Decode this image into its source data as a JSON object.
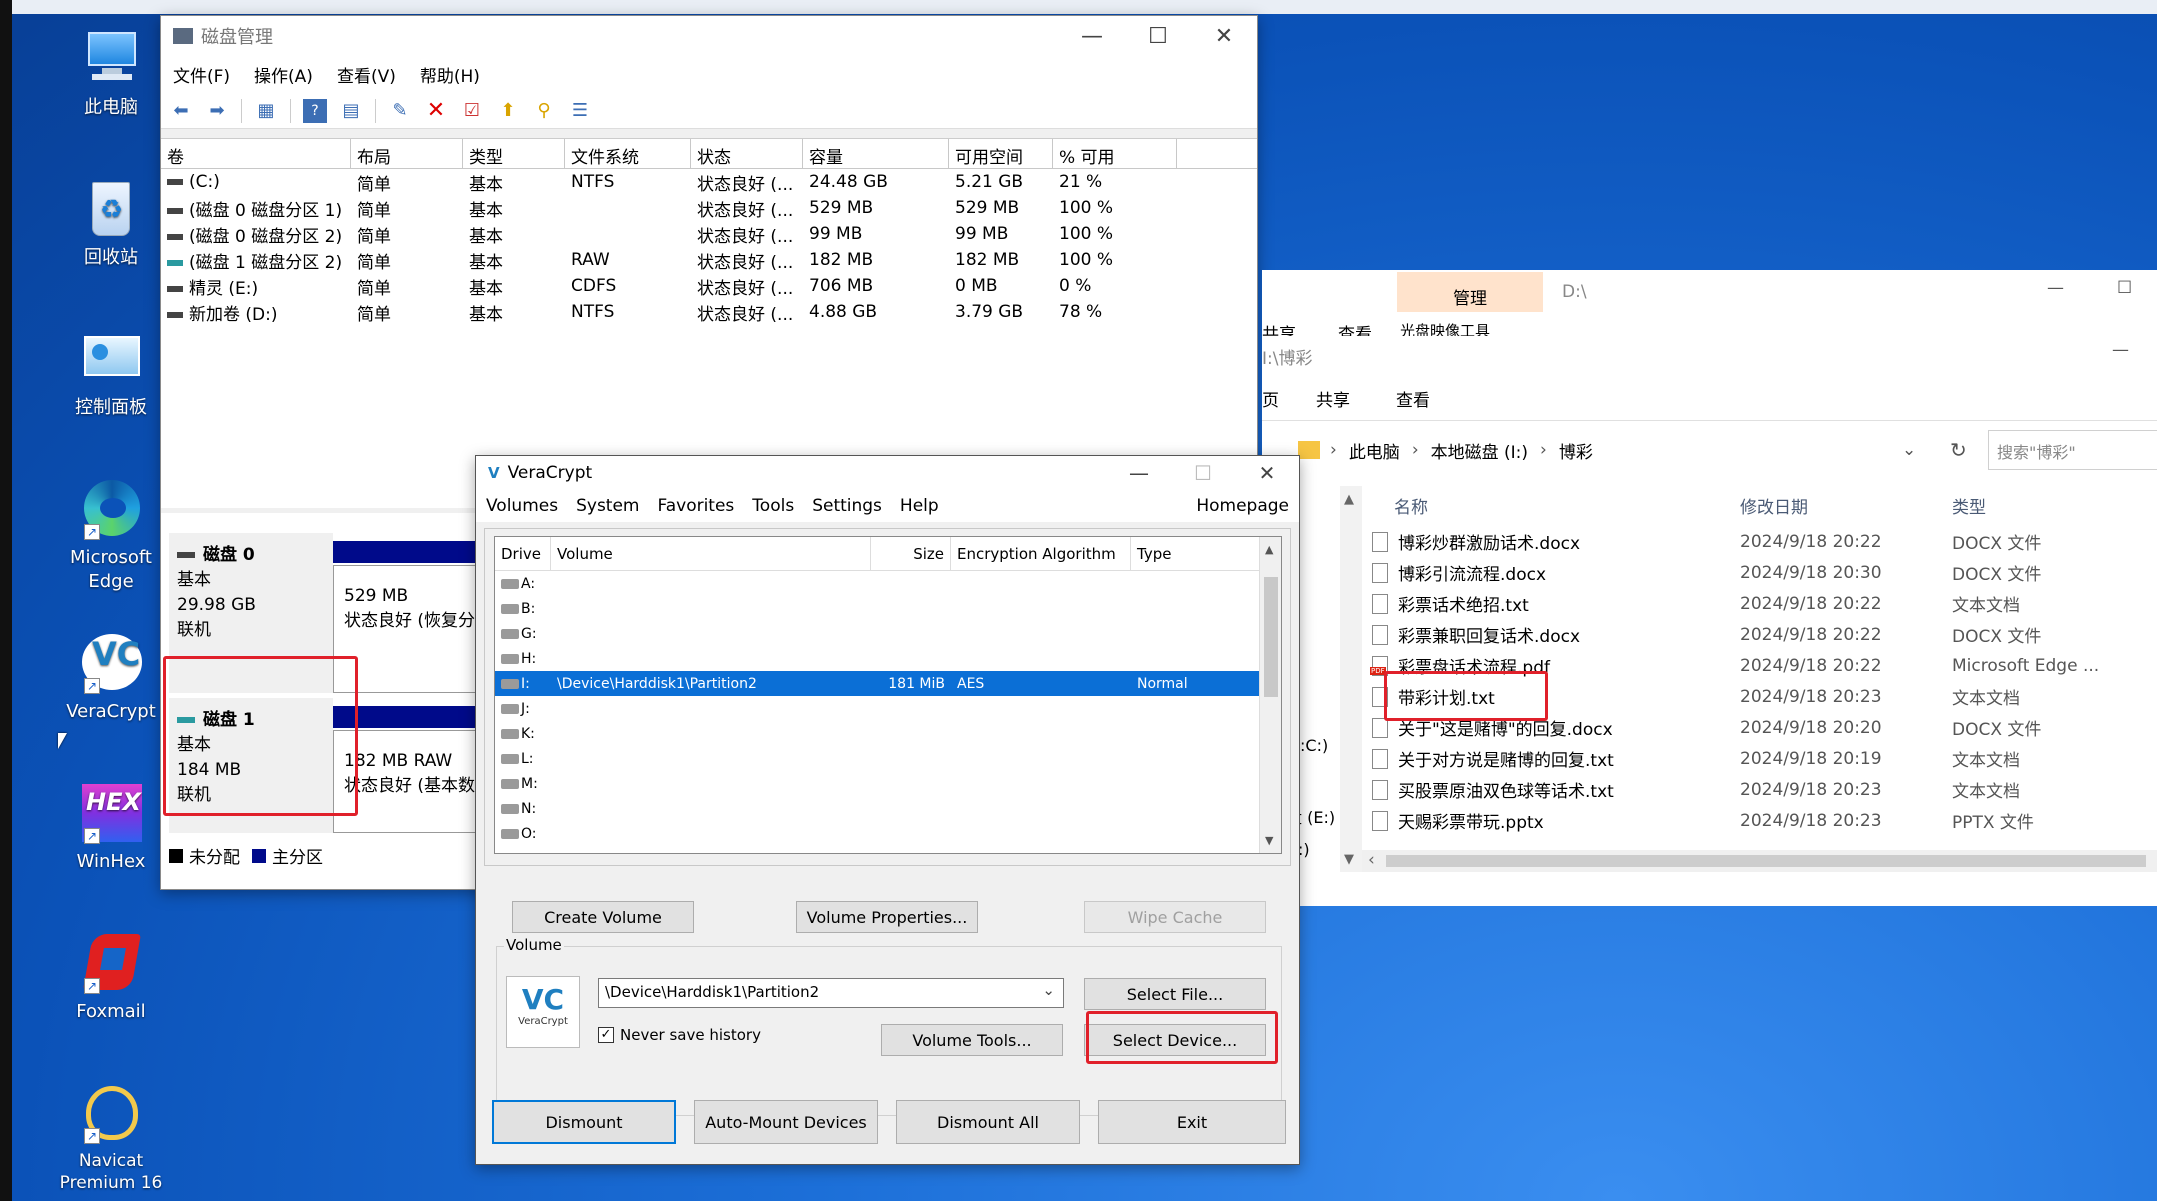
{
  "desktop_icons": [
    {
      "label": "此电脑",
      "icon": "computer-icon"
    },
    {
      "label": "回收站",
      "icon": "recycle-bin-icon"
    },
    {
      "label": "控制面板",
      "icon": "control-panel-icon"
    },
    {
      "label": "Microsoft Edge",
      "icon": "edge-icon"
    },
    {
      "label": "VeraCrypt",
      "icon": "veracrypt-icon"
    },
    {
      "label": "WinHex",
      "icon": "winhex-icon"
    },
    {
      "label": "Foxmail",
      "icon": "foxmail-icon"
    },
    {
      "label": "Navicat Premium 16",
      "icon": "navicat-icon"
    }
  ],
  "disk_mgmt": {
    "title": "磁盘管理",
    "menu": [
      "文件(F)",
      "操作(A)",
      "查看(V)",
      "帮助(H)"
    ],
    "columns": [
      "卷",
      "布局",
      "类型",
      "文件系统",
      "状态",
      "容量",
      "可用空间",
      "% 可用"
    ],
    "rows": [
      {
        "vol": "(C:)",
        "layout": "简单",
        "type": "基本",
        "fs": "NTFS",
        "status": "状态良好 (...",
        "cap": "24.48 GB",
        "free": "5.21 GB",
        "pct": "21 %"
      },
      {
        "vol": "(磁盘 0 磁盘分区 1)",
        "layout": "简单",
        "type": "基本",
        "fs": "",
        "status": "状态良好 (...",
        "cap": "529 MB",
        "free": "529 MB",
        "pct": "100 %"
      },
      {
        "vol": "(磁盘 0 磁盘分区 2)",
        "layout": "简单",
        "type": "基本",
        "fs": "",
        "status": "状态良好 (...",
        "cap": "99 MB",
        "free": "99 MB",
        "pct": "100 %"
      },
      {
        "vol": "(磁盘 1 磁盘分区 2)",
        "layout": "简单",
        "type": "基本",
        "fs": "RAW",
        "status": "状态良好 (...",
        "cap": "182 MB",
        "free": "182 MB",
        "pct": "100 %"
      },
      {
        "vol": "精灵 (E:)",
        "layout": "简单",
        "type": "基本",
        "fs": "CDFS",
        "status": "状态良好 (...",
        "cap": "706 MB",
        "free": "0 MB",
        "pct": "0 %"
      },
      {
        "vol": "新加卷 (D:)",
        "layout": "简单",
        "type": "基本",
        "fs": "NTFS",
        "status": "状态良好 (...",
        "cap": "4.88 GB",
        "free": "3.79 GB",
        "pct": "78 %"
      }
    ],
    "disk0": {
      "name": "磁盘 0",
      "type": "基本",
      "size": "29.98 GB",
      "state": "联机",
      "part_size": "529 MB",
      "part_status": "状态良好 (恢复分"
    },
    "disk1": {
      "name": "磁盘 1",
      "type": "基本",
      "size": "184 MB",
      "state": "联机",
      "part_size": "182 MB RAW",
      "part_status": "状态良好 (基本数"
    },
    "legend_unalloc": "未分配",
    "legend_primary": "主分区"
  },
  "explorer": {
    "manage_tab": "管理",
    "back_path": "D:\\",
    "share_tab_back": "共享",
    "view_tab_back": "查看",
    "optical_tools": "光盘映像工具",
    "path_title": "I:\\博彩",
    "tabs": [
      "页",
      "共享",
      "查看"
    ],
    "crumbs": [
      "此电脑",
      "本地磁盘 (I:)",
      "博彩"
    ],
    "search_placeholder": "搜索\"博彩\"",
    "columns": [
      "名称",
      "修改日期",
      "类型"
    ],
    "side_c": ":C:)",
    "side_e": "盘 (E:)",
    "side_i": ":)",
    "files": [
      {
        "name": "博彩炒群激励话术.docx",
        "date": "2024/9/18 20:22",
        "type": "DOCX 文件",
        "kind": "doc"
      },
      {
        "name": "博彩引流流程.docx",
        "date": "2024/9/18 20:30",
        "type": "DOCX 文件",
        "kind": "doc"
      },
      {
        "name": "彩票话术绝招.txt",
        "date": "2024/9/18 20:22",
        "type": "文本文档",
        "kind": "txt"
      },
      {
        "name": "彩票兼职回复话术.docx",
        "date": "2024/9/18 20:22",
        "type": "DOCX 文件",
        "kind": "doc"
      },
      {
        "name": "彩票盘话术流程.pdf",
        "date": "2024/9/18 20:22",
        "type": "Microsoft Edge ...",
        "kind": "pdf"
      },
      {
        "name": "带彩计划.txt",
        "date": "2024/9/18 20:23",
        "type": "文本文档",
        "kind": "txt"
      },
      {
        "name": "关于\"这是赌博\"的回复.docx",
        "date": "2024/9/18 20:20",
        "type": "DOCX 文件",
        "kind": "doc"
      },
      {
        "name": "关于对方说是赌博的回复.txt",
        "date": "2024/9/18 20:19",
        "type": "文本文档",
        "kind": "txt"
      },
      {
        "name": "买股票原油双色球等话术.txt",
        "date": "2024/9/18 20:23",
        "type": "文本文档",
        "kind": "txt"
      },
      {
        "name": "天赐彩票带玩.pptx",
        "date": "2024/9/18 20:23",
        "type": "PPTX 文件",
        "kind": "doc"
      }
    ]
  },
  "veracrypt": {
    "title": "VeraCrypt",
    "menu": [
      "Volumes",
      "System",
      "Favorites",
      "Tools",
      "Settings",
      "Help"
    ],
    "homepage": "Homepage",
    "columns": [
      "Drive",
      "Volume",
      "Size",
      "Encryption Algorithm",
      "Type"
    ],
    "drives": [
      {
        "drive": "A:",
        "volume": "",
        "size": "",
        "algo": "",
        "type": ""
      },
      {
        "drive": "B:",
        "volume": "",
        "size": "",
        "algo": "",
        "type": ""
      },
      {
        "drive": "G:",
        "volume": "",
        "size": "",
        "algo": "",
        "type": ""
      },
      {
        "drive": "H:",
        "volume": "",
        "size": "",
        "algo": "",
        "type": ""
      },
      {
        "drive": "I:",
        "volume": "\\Device\\Harddisk1\\Partition2",
        "size": "181 MiB",
        "algo": "AES",
        "type": "Normal"
      },
      {
        "drive": "J:",
        "volume": "",
        "size": "",
        "algo": "",
        "type": ""
      },
      {
        "drive": "K:",
        "volume": "",
        "size": "",
        "algo": "",
        "type": ""
      },
      {
        "drive": "L:",
        "volume": "",
        "size": "",
        "algo": "",
        "type": ""
      },
      {
        "drive": "M:",
        "volume": "",
        "size": "",
        "algo": "",
        "type": ""
      },
      {
        "drive": "N:",
        "volume": "",
        "size": "",
        "algo": "",
        "type": ""
      },
      {
        "drive": "O:",
        "volume": "",
        "size": "",
        "algo": "",
        "type": ""
      }
    ],
    "create_volume": "Create Volume",
    "volume_properties": "Volume Properties...",
    "wipe_cache": "Wipe Cache",
    "volume_group": "Volume",
    "volume_path": "\\Device\\Harddisk1\\Partition2",
    "select_file": "Select File...",
    "never_save_history": "Never save history",
    "volume_tools": "Volume Tools...",
    "select_device": "Select Device...",
    "dismount": "Dismount",
    "auto_mount": "Auto-Mount Devices",
    "dismount_all": "Dismount All",
    "exit": "Exit",
    "logo_text": "VeraCrypt"
  },
  "colors": {
    "accent": "#0b6fd6",
    "highlight_box": "#e0202a",
    "partition_bar": "#000a8a"
  }
}
